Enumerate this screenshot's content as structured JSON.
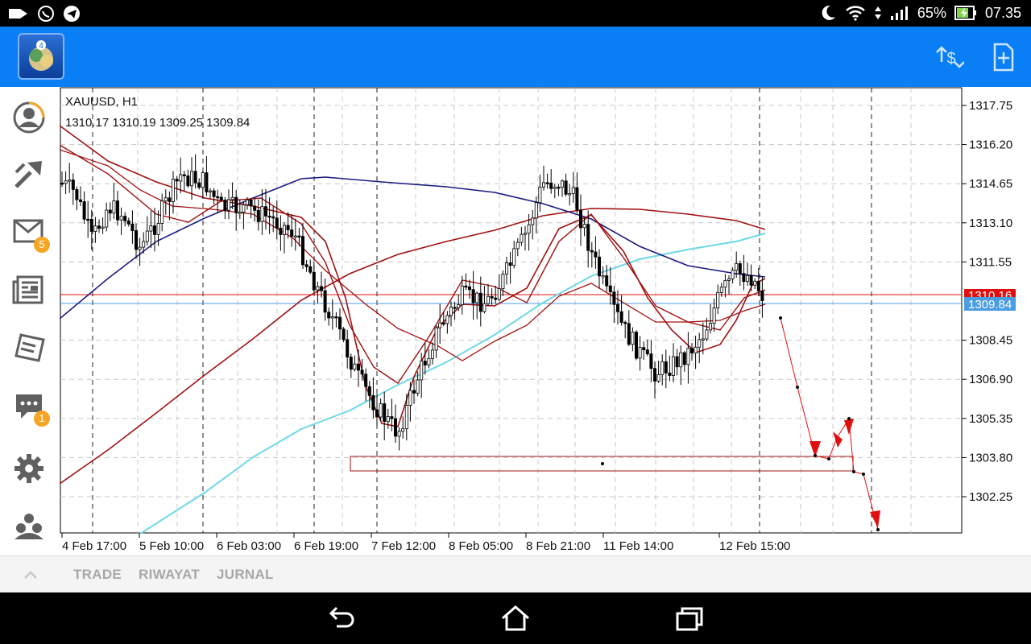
{
  "status_bar": {
    "battery_percent": "65%",
    "time": "07.35",
    "icons": [
      "notification-icon",
      "whatsapp-icon",
      "telegram-icon",
      "moon-icon",
      "wifi-icon",
      "signal-icon",
      "battery-charging-icon"
    ]
  },
  "app_bar": {
    "logo_icon": "metatrader-logo",
    "actions": [
      {
        "icon": "symbol-quotes-icon"
      },
      {
        "icon": "new-order-icon"
      }
    ],
    "color": "#0a7ff5"
  },
  "sidebar": {
    "items": [
      {
        "icon": "account-icon"
      },
      {
        "icon": "trade-arrow-icon"
      },
      {
        "icon": "mail-icon",
        "badge": "5"
      },
      {
        "icon": "news-icon"
      },
      {
        "icon": "journal-icon"
      },
      {
        "icon": "chat-icon",
        "badge": "1"
      },
      {
        "icon": "settings-icon"
      },
      {
        "icon": "community-icon"
      }
    ]
  },
  "chart": {
    "symbol": "XAUUSD, H1",
    "ohlc": "1310.17 1310.19 1309.25 1309.84",
    "current_price": "1309.84",
    "line_price": "1310.16",
    "price_labels": [
      "1317.75",
      "1316.20",
      "1314.65",
      "1313.10",
      "1311.55",
      "1310.16",
      "1309.84",
      "1308.45",
      "1306.90",
      "1305.35",
      "1303.80",
      "1302.25"
    ],
    "time_labels": [
      "4 Feb 17:00",
      "5 Feb 10:00",
      "6 Feb 03:00",
      "6 Feb 19:00",
      "7 Feb 12:00",
      "8 Feb 05:00",
      "8 Feb 21:00",
      "11 Feb 14:00",
      "12 Feb 15:00"
    ],
    "colors": {
      "candle": "#000000",
      "ma_dark_red": "#a01010",
      "ma_navy": "#1a1a80",
      "ma_cyan": "#6fd8e6",
      "label_red": "#e01010",
      "label_blue": "#4a9de0"
    }
  },
  "bottom_tabs": {
    "items": [
      "TRADE",
      "RIWAYAT",
      "JURNAL"
    ]
  },
  "nav_bar": {
    "buttons": [
      {
        "icon": "back-icon"
      },
      {
        "icon": "home-icon"
      },
      {
        "icon": "recents-icon"
      }
    ]
  }
}
